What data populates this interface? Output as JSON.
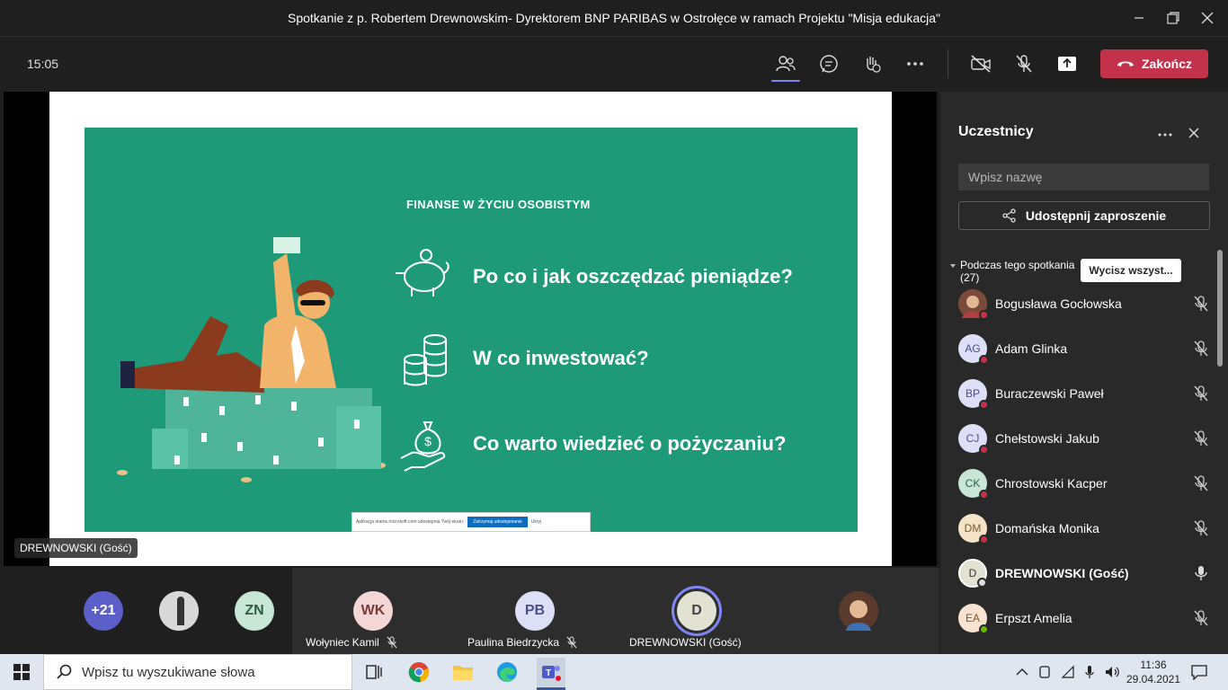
{
  "window": {
    "title": "Spotkanie z p. Robertem Drewnowskim- Dyrektorem BNP PARIBAS w Ostrołęce w ramach Projektu \"Misja edukacja\""
  },
  "toolbar": {
    "clock": "15:05",
    "end_label": "Zakończ",
    "end_color": "#c4314b"
  },
  "slide": {
    "heading": "FINANSE W ŻYCIU OSOBISTYM",
    "bullets": [
      "Po co i jak oszczędzać pieniądze?",
      "W co inwestować?",
      "Co warto wiedzieć o pożyczaniu?"
    ],
    "share_notice": "Aplikacja teams.microsoft.com udostępnia Twój ekran.",
    "share_stop": "Zatrzymaj udostępnianie",
    "share_hide": "Ukryj",
    "bg_color": "#1f9a78"
  },
  "presenter_tag": "DREWNOWSKI (Gość)",
  "strip": {
    "overflow": "+21",
    "zn": "ZN",
    "tiles": [
      {
        "initials": "WK",
        "name": "Wołyniec Kamil"
      },
      {
        "initials": "PB",
        "name": "Paulina Biedrzycka"
      },
      {
        "initials": "D",
        "name": "DREWNOWSKI (Gość)"
      }
    ]
  },
  "panel": {
    "title": "Uczestnicy",
    "search_placeholder": "Wpisz nazwę",
    "share_invite": "Udostępnij zaproszenie",
    "section": "Podczas tego spotkania",
    "count": "(27)",
    "mute_all": "Wycisz wszyst...",
    "participants": [
      {
        "initials": "",
        "name": "Bogusława Gocłowska",
        "status": "busy"
      },
      {
        "initials": "AG",
        "name": "Adam Glinka",
        "status": "busy"
      },
      {
        "initials": "BP",
        "name": "Buraczewski Paweł",
        "status": "busy"
      },
      {
        "initials": "CJ",
        "name": "Chełstowski Jakub",
        "status": "busy"
      },
      {
        "initials": "CK",
        "name": "Chrostowski Kacper",
        "status": "busy"
      },
      {
        "initials": "DM",
        "name": "Domańska Monika",
        "status": "busy"
      },
      {
        "initials": "D",
        "name": "DREWNOWSKI (Gość)",
        "status": "offline"
      },
      {
        "initials": "EA",
        "name": "Erpszt Amelia",
        "status": "available"
      }
    ]
  },
  "taskbar": {
    "search_placeholder": "Wpisz tu wyszukiwane słowa",
    "time": "11:36",
    "date": "29.04.2021"
  }
}
